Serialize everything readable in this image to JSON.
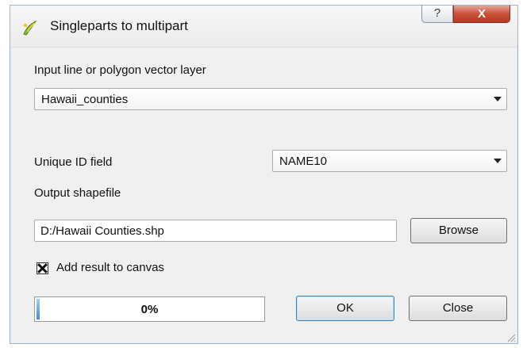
{
  "window": {
    "title": "Singleparts to multipart",
    "help_label": "?",
    "close_label": "X"
  },
  "input_layer": {
    "label": "Input line or polygon vector layer",
    "value": "Hawaii_counties"
  },
  "unique_id": {
    "label": "Unique ID field",
    "value": "NAME10"
  },
  "output": {
    "label": "Output shapefile",
    "value": "D:/Hawaii Counties.shp",
    "browse_label": "Browse"
  },
  "add_to_canvas": {
    "label": "Add result to canvas",
    "checked": true
  },
  "progress": {
    "value": 0,
    "text": "0%"
  },
  "buttons": {
    "ok_label": "OK",
    "close_label": "Close"
  },
  "colors": {
    "close_button": "#c9503b",
    "progress_fill": "#3d8ee0"
  },
  "icons": {
    "app": "qgis-tool-icon",
    "resize": "resize-grip-icon"
  }
}
